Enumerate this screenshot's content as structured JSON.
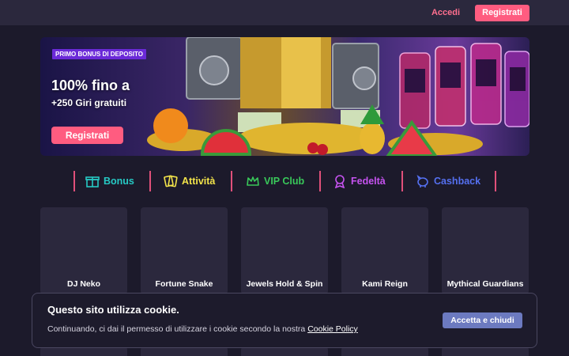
{
  "header": {
    "login_label": "Accedi",
    "register_label": "Registrati"
  },
  "banner": {
    "tag": "PRIMO BONUS DI DEPOSITO",
    "headline": "100% fino a",
    "subline": "+250 Giri gratuiti",
    "register_label": "Registrati"
  },
  "nav": {
    "items": [
      {
        "label": "Bonus",
        "icon": "gift-icon",
        "color": "#26c9c4"
      },
      {
        "label": "Attività",
        "icon": "cards-icon",
        "color": "#f2e34a"
      },
      {
        "label": "VIP Club",
        "icon": "crown-icon",
        "color": "#39c85a"
      },
      {
        "label": "Fedeltà",
        "icon": "medal-icon",
        "color": "#c653f0"
      },
      {
        "label": "Cashback",
        "icon": "piggy-bank-icon",
        "color": "#5570f0"
      }
    ]
  },
  "games": [
    {
      "title": "DJ Neko"
    },
    {
      "title": "Fortune Snake"
    },
    {
      "title": "Jewels Hold & Spin"
    },
    {
      "title": "Kami Reign"
    },
    {
      "title": "Mythical Guardians"
    }
  ],
  "cookie": {
    "title": "Questo sito utilizza cookie.",
    "text": "Continuando, ci dai il permesso di utilizzare i cookie secondo la nostra",
    "link_label": "Cookie Policy",
    "accept_label": "Accetta e chiudi"
  },
  "colors": {
    "accent": "#ff5c80",
    "background": "#1c1a2b",
    "card": "#2b283d",
    "accept_button": "#6c7ac0"
  }
}
